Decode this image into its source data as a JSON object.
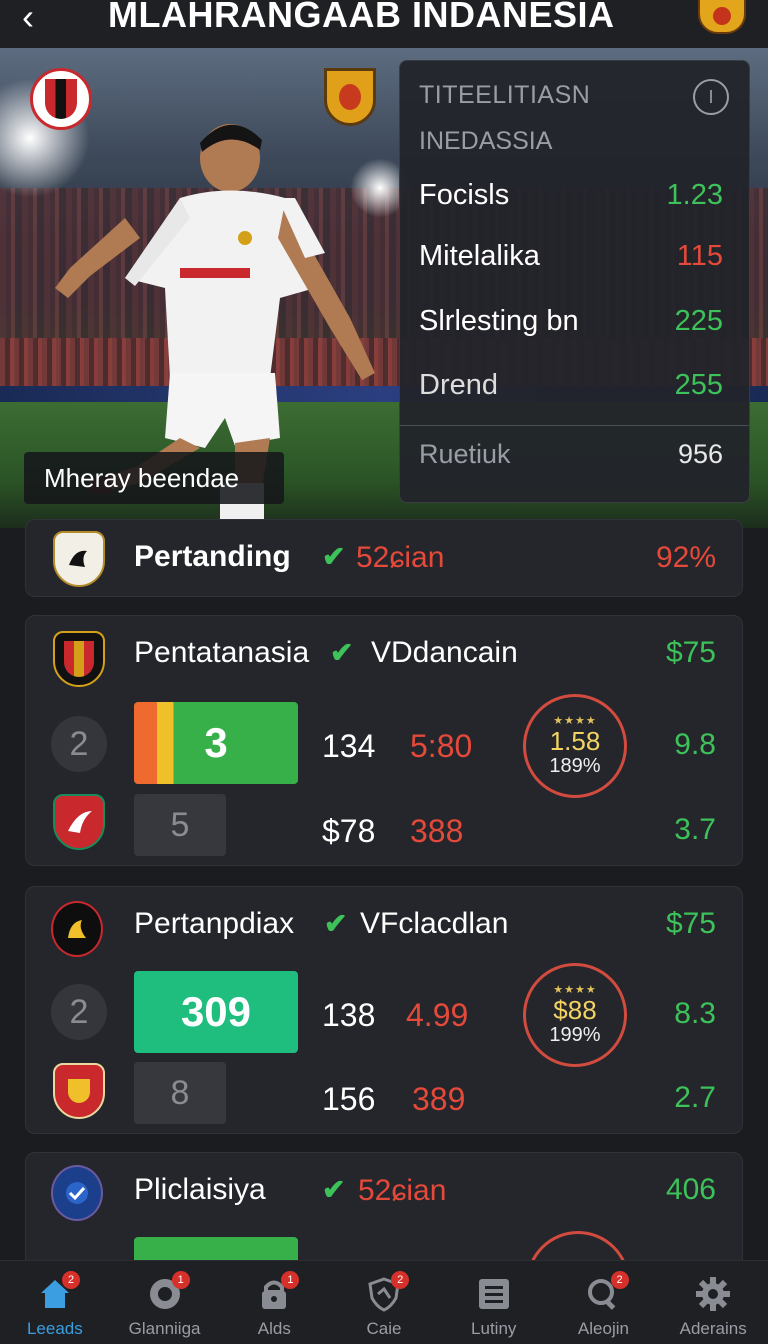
{
  "header": {
    "back_icon": "chevron-left-icon",
    "title": "MLAHRANGAAB INDANESIA",
    "badge_icon": "club-crest-icon"
  },
  "hero": {
    "caption": "Mheray beendae"
  },
  "stats_panel": {
    "title": "TITEELITIASN",
    "subtitle": "INEDASSIA",
    "info_icon": "info-icon",
    "rows": [
      {
        "label": "Focisls",
        "value": "1.23",
        "color": "#3dc25a"
      },
      {
        "label": "Mitelalika",
        "value": "115",
        "color": "#e4493a"
      },
      {
        "label": "Slrlesting bn",
        "value": "225",
        "color": "#3dc25a"
      },
      {
        "label": "Drend",
        "value": "255",
        "color": "#3dc25a"
      }
    ],
    "footer_label": "Ruetiuk",
    "footer_value": "956"
  },
  "match_summary": {
    "team": "Pertanding",
    "status": "52ɕian",
    "value": "92%"
  },
  "matches": [
    {
      "team": "Pentatanasia",
      "status": "VDdancain",
      "right": "$75",
      "rank_top": "2",
      "score_top": "3",
      "score_bottom": "5",
      "n1": "134",
      "odd1": "5:80",
      "n2": "$78",
      "odd2": "388",
      "rating_stars": "★★★★",
      "rating_value": "1.58",
      "rating_pct": "189%",
      "side_top": "9.8",
      "side_bottom": "3.7"
    },
    {
      "team": "Pertanpdiax",
      "status": "VFclacdlan",
      "right": "$75",
      "rank_top": "2",
      "score_top": "309",
      "score_bottom": "8",
      "n1": "138",
      "odd1": "4.99",
      "n2": "156",
      "odd2": "389",
      "rating_stars": "★★★★",
      "rating_value": "$88",
      "rating_pct": "199%",
      "side_top": "8.3",
      "side_bottom": "2.7"
    },
    {
      "team": "Pliclaisiya",
      "status": "52ɕian",
      "right": "406",
      "rating_stars": "★★★★"
    }
  ],
  "nav": [
    {
      "label": "Leeads",
      "icon": "home-icon",
      "badge": "2",
      "active": true
    },
    {
      "label": "Glanniiga",
      "icon": "target-icon",
      "badge": "1",
      "active": false
    },
    {
      "label": "Alds",
      "icon": "lock-icon",
      "badge": "1",
      "active": false
    },
    {
      "label": "Caie",
      "icon": "shield-icon",
      "badge": "2",
      "active": false
    },
    {
      "label": "Lutiny",
      "icon": "list-icon",
      "badge": "",
      "active": false
    },
    {
      "label": "Aleojin",
      "icon": "search-icon",
      "badge": "2",
      "active": false
    },
    {
      "label": "Aderains",
      "icon": "gear-icon",
      "badge": "",
      "active": false
    }
  ]
}
